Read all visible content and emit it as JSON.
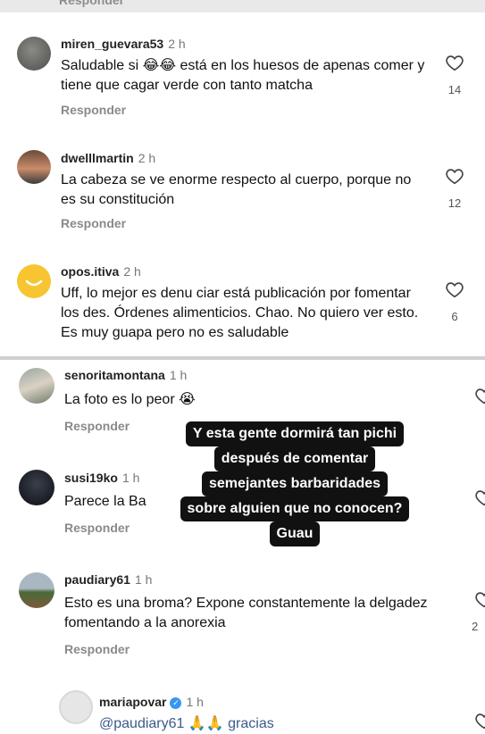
{
  "top": {
    "reply_label": "Responder"
  },
  "comments": [
    {
      "username": "miren_guevara53",
      "time": "2 h",
      "text": "Saludable si 😂😂 está en los huesos de apenas comer y tiene que cagar verde con tanto matcha",
      "reply": "Responder",
      "likes": "14"
    },
    {
      "username": "dwelllmartin",
      "time": "2 h",
      "text": "La cabeza se ve enorme respecto al cuerpo, porque no es su constitución",
      "reply": "Responder",
      "likes": "12"
    },
    {
      "username": "opos.itiva",
      "time": "2 h",
      "text": "Uff, lo mejor es denu ciar está publicación por fomentar los des. Órdenes alimenticios. Chao. No quiero ver esto. Es muy guapa pero no es saludable",
      "likes": "6"
    },
    {
      "username": "senoritamontana",
      "time": "1 h",
      "text": "La foto es lo peor 😭",
      "reply": "Responder"
    },
    {
      "username": "susi19ko",
      "time": "1 h",
      "text": "Parece la Ba",
      "reply": "Responder"
    },
    {
      "username": "paudiary61",
      "time": "1 h",
      "text": "Esto es una broma? Expone constantemente la delgadez fomentando a la anorexia",
      "reply": "Responder",
      "likes": "2"
    },
    {
      "username": "mariapovar",
      "time": "1 h",
      "text": "@paudiary61 🙏🙏 gracias"
    }
  ],
  "overlay_lines": [
    "Y esta gente dormirá tan pichi",
    "después de comentar",
    "semejantes barbaridades",
    "sobre alguien que no conocen?",
    "Guau"
  ],
  "icons": {
    "like": "heart-outline-icon",
    "verified": "verified-badge-icon"
  },
  "colors": {
    "verified": "#3897f0",
    "overlay_bg": "#111111"
  }
}
